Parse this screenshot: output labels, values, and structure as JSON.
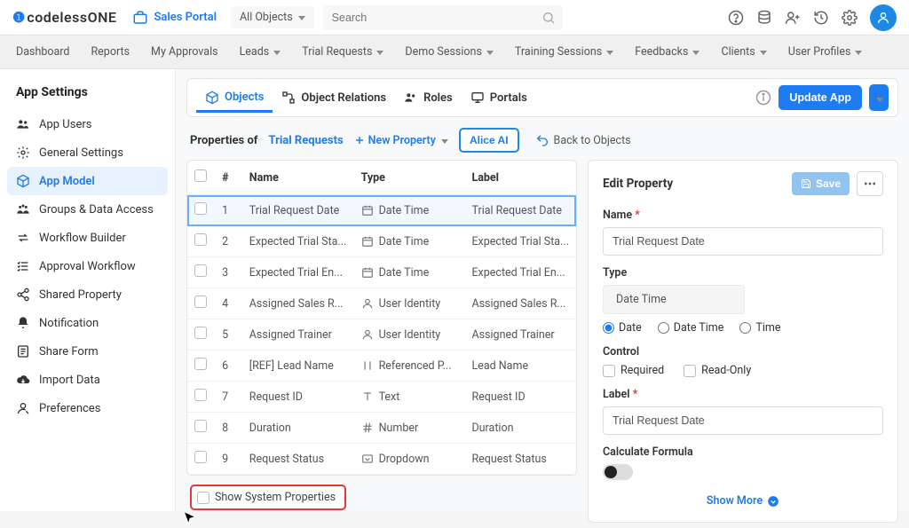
{
  "header": {
    "brand_prefix": "❶",
    "brand_name": "codelessONE",
    "portal_label": "Sales Portal",
    "all_objects_label": "All Objects",
    "search_placeholder": "Search"
  },
  "nav": {
    "items": [
      "Dashboard",
      "Reports",
      "My Approvals",
      "Leads",
      "Trial Requests",
      "Demo Sessions",
      "Training Sessions",
      "Feedbacks",
      "Clients",
      "User Profiles"
    ]
  },
  "sidebar": {
    "title": "App Settings",
    "items": [
      {
        "label": "App Users"
      },
      {
        "label": "General Settings"
      },
      {
        "label": "App Model"
      },
      {
        "label": "Groups & Data Access"
      },
      {
        "label": "Workflow Builder"
      },
      {
        "label": "Approval Workflow"
      },
      {
        "label": "Shared Property"
      },
      {
        "label": "Notification"
      },
      {
        "label": "Share Form"
      },
      {
        "label": "Import Data"
      },
      {
        "label": "Preferences"
      }
    ]
  },
  "tabs": {
    "objects": "Objects",
    "relations": "Object Relations",
    "roles": "Roles",
    "portals": "Portals",
    "update": "Update App"
  },
  "subbar": {
    "properties_of": "Properties of",
    "entity": "Trial Requests",
    "new_property": "New Property",
    "alice": "Alice AI",
    "back": "Back to Objects"
  },
  "table": {
    "head": {
      "num": "#",
      "name": "Name",
      "type": "Type",
      "label": "Label"
    },
    "rows": [
      {
        "n": "1",
        "name": "Trial Request Date",
        "type": "Date Time",
        "label": "Trial Request Date",
        "icon": "calendar"
      },
      {
        "n": "2",
        "name": "Expected Trial Sta...",
        "type": "Date Time",
        "label": "Expected Trial Sta...",
        "icon": "calendar"
      },
      {
        "n": "3",
        "name": "Expected Trial En...",
        "type": "Date Time",
        "label": "Expected Trial En...",
        "icon": "calendar"
      },
      {
        "n": "4",
        "name": "Assigned Sales R...",
        "type": "User Identity",
        "label": "Assigned Sales R...",
        "icon": "user"
      },
      {
        "n": "5",
        "name": "Assigned Trainer",
        "type": "User Identity",
        "label": "Assigned Trainer",
        "icon": "user"
      },
      {
        "n": "6",
        "name": "[REF] Lead Name",
        "type": "Referenced P...",
        "label": "Lead Name",
        "icon": "ref"
      },
      {
        "n": "7",
        "name": "Request ID",
        "type": "Text",
        "label": "Request ID",
        "icon": "text"
      },
      {
        "n": "8",
        "name": "Duration",
        "type": "Number",
        "label": "Duration",
        "icon": "hash"
      },
      {
        "n": "9",
        "name": "Request Status",
        "type": "Dropdown",
        "label": "Request Status",
        "icon": "dropdown"
      }
    ],
    "show_system": "Show System Properties"
  },
  "panel": {
    "title": "Edit Property",
    "save": "Save",
    "name_label": "Name",
    "name_value": "Trial Request Date",
    "type_label": "Type",
    "type_value": "Date Time",
    "radio_date": "Date",
    "radio_datetime": "Date Time",
    "radio_time": "Time",
    "control_label": "Control",
    "required": "Required",
    "readonly": "Read-Only",
    "label_label": "Label",
    "label_value": "Trial Request Date",
    "calc": "Calculate Formula",
    "show_more": "Show More"
  }
}
